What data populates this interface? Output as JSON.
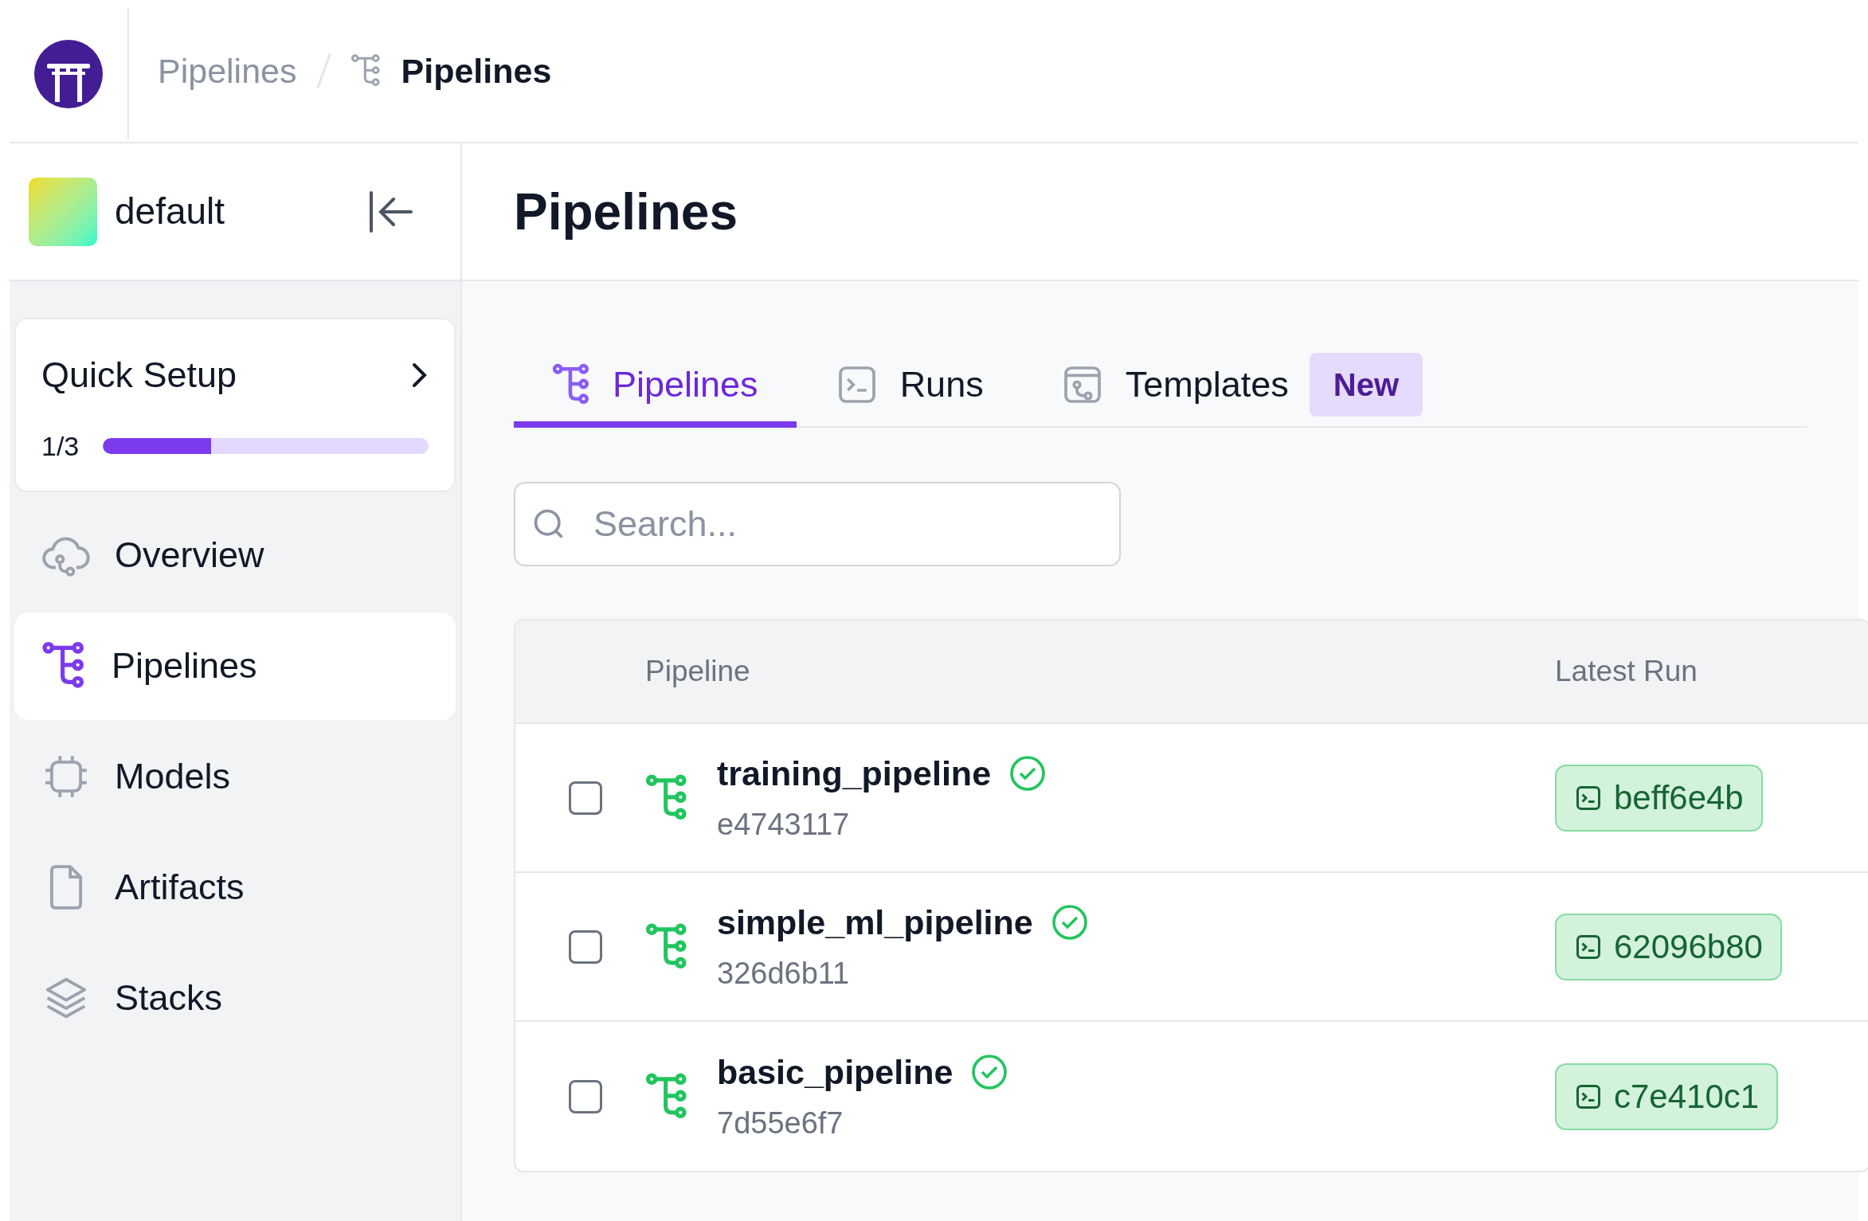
{
  "breadcrumb": {
    "parent": "Pipelines",
    "current": "Pipelines"
  },
  "workspace": {
    "name": "default"
  },
  "quick_setup": {
    "title": "Quick Setup",
    "progress": "1/3",
    "level": 0.333
  },
  "sidebar": {
    "items": [
      {
        "label": "Overview",
        "selected": false
      },
      {
        "label": "Pipelines",
        "selected": true
      },
      {
        "label": "Models",
        "selected": false
      },
      {
        "label": "Artifacts",
        "selected": false
      },
      {
        "label": "Stacks",
        "selected": false
      }
    ]
  },
  "page_title": "Pipelines",
  "tabs": [
    {
      "label": "Pipelines",
      "selected": true
    },
    {
      "label": "Runs",
      "selected": false
    },
    {
      "label": "Templates",
      "selected": false,
      "badge": "New"
    }
  ],
  "search": {
    "placeholder": "Search..."
  },
  "table": {
    "columns": [
      "Pipeline",
      "Latest Run"
    ],
    "rows": [
      {
        "checked": false,
        "name": "training_pipeline",
        "id": "e4743117",
        "latest_run": "beff6e4b"
      },
      {
        "checked": false,
        "name": "simple_ml_pipeline",
        "id": "326d6b11",
        "latest_run": "62096b80"
      },
      {
        "checked": false,
        "name": "basic_pipeline",
        "id": "7d55e6f7",
        "latest_run": "c7e410c1"
      }
    ]
  }
}
